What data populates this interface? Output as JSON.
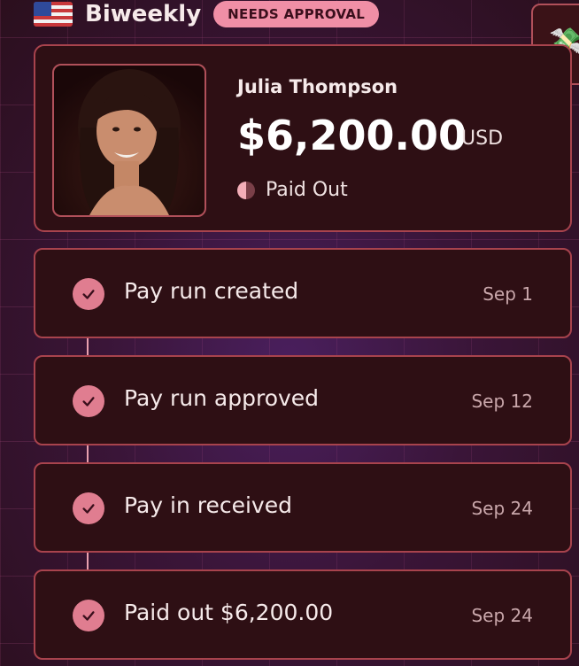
{
  "header": {
    "frequency": "Biweekly",
    "badge": "NEEDS APPROVAL",
    "flag_icon": "us-flag-icon",
    "corner_icon": "money-with-wings-icon"
  },
  "employee": {
    "name": "Julia Thompson",
    "amount": "$6,200.00",
    "currency": "USD",
    "status": "Paid Out"
  },
  "timeline": [
    {
      "label": "Pay run created",
      "date": "Sep 1"
    },
    {
      "label": "Pay run approved",
      "date": "Sep 12"
    },
    {
      "label": "Pay in received",
      "date": "Sep 24"
    },
    {
      "label": "Paid out $6,200.00",
      "date": "Sep 24"
    }
  ],
  "colors": {
    "accent": "#f08fa6",
    "card_bg": "#2e0f14",
    "card_border": "#a8434d",
    "check": "#e07d90"
  }
}
